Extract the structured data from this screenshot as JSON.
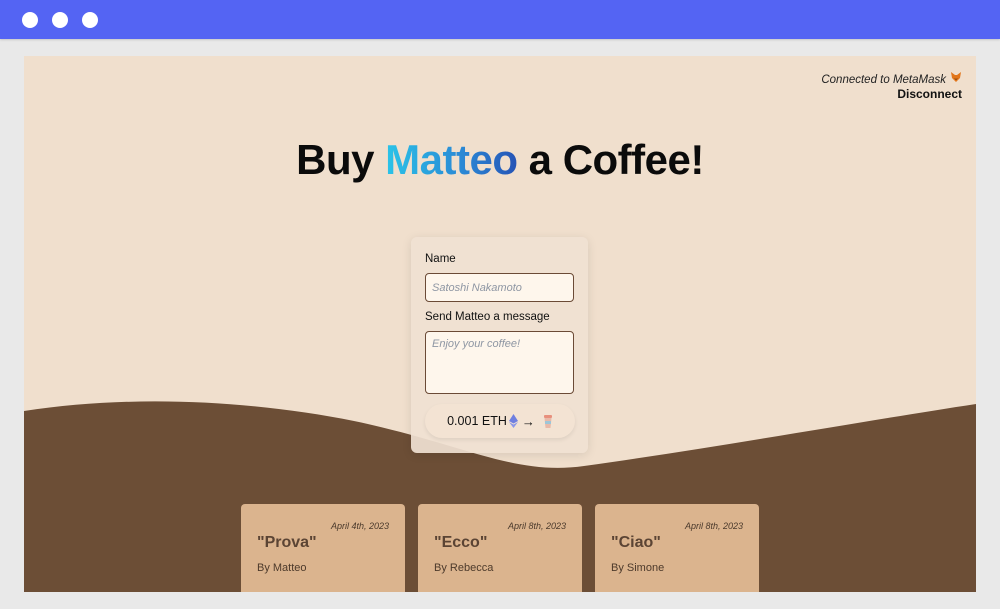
{
  "connection": {
    "status": "Connected to MetaMask",
    "icon": "fox-icon",
    "disconnect_label": "Disconnect"
  },
  "title": {
    "prefix": "Buy ",
    "name": "Matteo",
    "suffix": " a Coffee!"
  },
  "form": {
    "name_label": "Name",
    "name_placeholder": "Satoshi Nakamoto",
    "message_label": "Send Matteo a message",
    "message_placeholder": "Enjoy your coffee!",
    "buy_amount": "0.001 ETH",
    "buy_arrow": "→"
  },
  "memos": [
    {
      "date": "April 4th, 2023",
      "message": "\"Prova\"",
      "author": "By Matteo"
    },
    {
      "date": "April 8th, 2023",
      "message": "\"Ecco\"",
      "author": "By Rebecca"
    },
    {
      "date": "April 8th, 2023",
      "message": "\"Ciao\"",
      "author": "By Simone"
    }
  ],
  "colors": {
    "titlebar": "#5464f3",
    "background": "#f0dfcd",
    "wave": "#6c4e36",
    "memo_card": "#dbb48e",
    "accent_gradient_start": "#2bc4e8",
    "accent_gradient_end": "#2553b5"
  }
}
